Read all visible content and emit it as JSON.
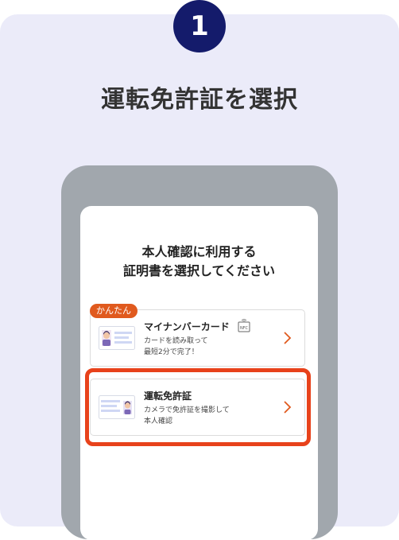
{
  "step": {
    "number": "1"
  },
  "heading": "運転免許証を選択",
  "screen": {
    "title_line1": "本人確認に利用する",
    "title_line2": "証明書を選択してください"
  },
  "options": [
    {
      "badge": "かんたん",
      "title": "マイナンバーカード",
      "desc_line1": "カードを読み取って",
      "desc_line2": "最短2分で完了！",
      "icon": "nfc-icon"
    },
    {
      "title": "運転免許証",
      "desc_line1": "カメラで免許証を撮影して",
      "desc_line2": "本人確認"
    }
  ],
  "colors": {
    "accent": "#e8421b",
    "step_circle": "#141b6b",
    "background": "#ebebf9",
    "phone_frame": "#a1a7ad"
  }
}
